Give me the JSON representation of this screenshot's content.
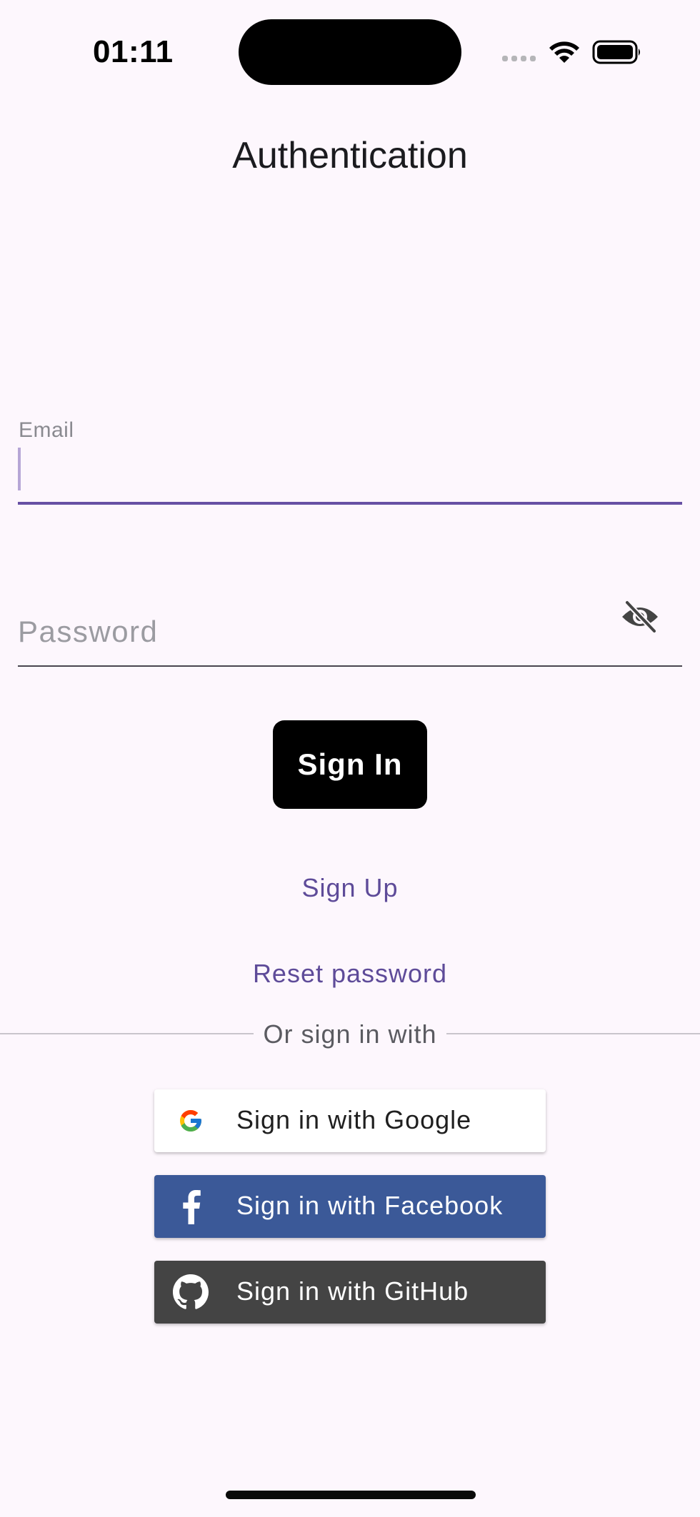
{
  "status_bar": {
    "time": "01:11",
    "icons": [
      "signal-icon",
      "wifi-icon",
      "battery-icon"
    ]
  },
  "header": {
    "title": "Authentication"
  },
  "form": {
    "email_label": "Email",
    "email_value": "",
    "password_placeholder": "Password",
    "password_value": "",
    "password_toggle_icon": "eye-off-icon"
  },
  "actions": {
    "sign_in_label": "Sign In",
    "sign_up_label": "Sign Up",
    "reset_password_label": "Reset password"
  },
  "divider": {
    "label": "Or sign in with"
  },
  "social": {
    "google": {
      "label": "Sign in with Google",
      "color": "#ffffff",
      "icon": "google-icon"
    },
    "facebook": {
      "label": "Sign in with Facebook",
      "color": "#3b5998",
      "icon": "facebook-icon"
    },
    "github": {
      "label": "Sign in with GitHub",
      "color": "#444444",
      "icon": "github-icon"
    }
  },
  "colors": {
    "background": "#fdf7fd",
    "accent": "#6750a4",
    "link": "#5e4b99",
    "primary_button": "#000000"
  }
}
